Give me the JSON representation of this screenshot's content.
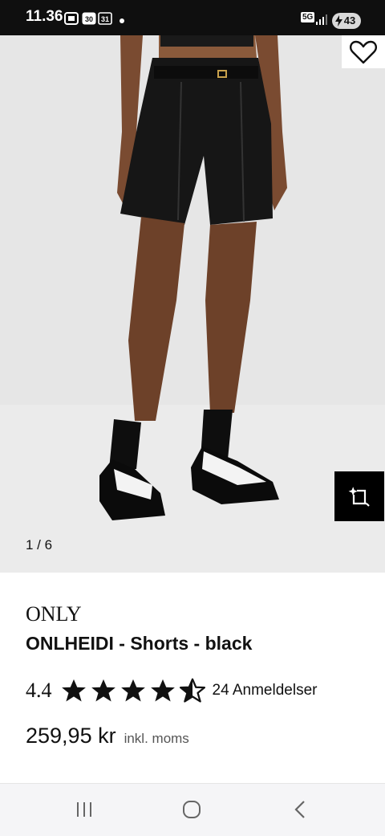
{
  "status_bar": {
    "time": "11.36",
    "network": "5G",
    "battery": "43",
    "icons": [
      "screenshot-icon",
      "calendar-30-icon",
      "calendar-31-icon",
      "notification-dot-icon",
      "signal-icon",
      "battery-charging-icon"
    ]
  },
  "gallery": {
    "counter": "1 / 6",
    "wishlist_icon": "heart-outline-icon",
    "ar_icon": "ar-view-icon"
  },
  "product": {
    "brand": "ONLY",
    "name": "ONLHEIDI - Shorts - black",
    "rating": "4.4",
    "rating_stars": 4.5,
    "reviews": "24 Anmeldelser",
    "price": "259,95 kr",
    "vat_note": "inkl. moms"
  },
  "nav": {
    "icons": [
      "recent-apps-icon",
      "home-icon",
      "back-icon"
    ]
  },
  "colors": {
    "background": "#ffffff",
    "text": "#111111",
    "image_bg": "#e9e9e9",
    "status_bar": "#0f0f0f"
  }
}
